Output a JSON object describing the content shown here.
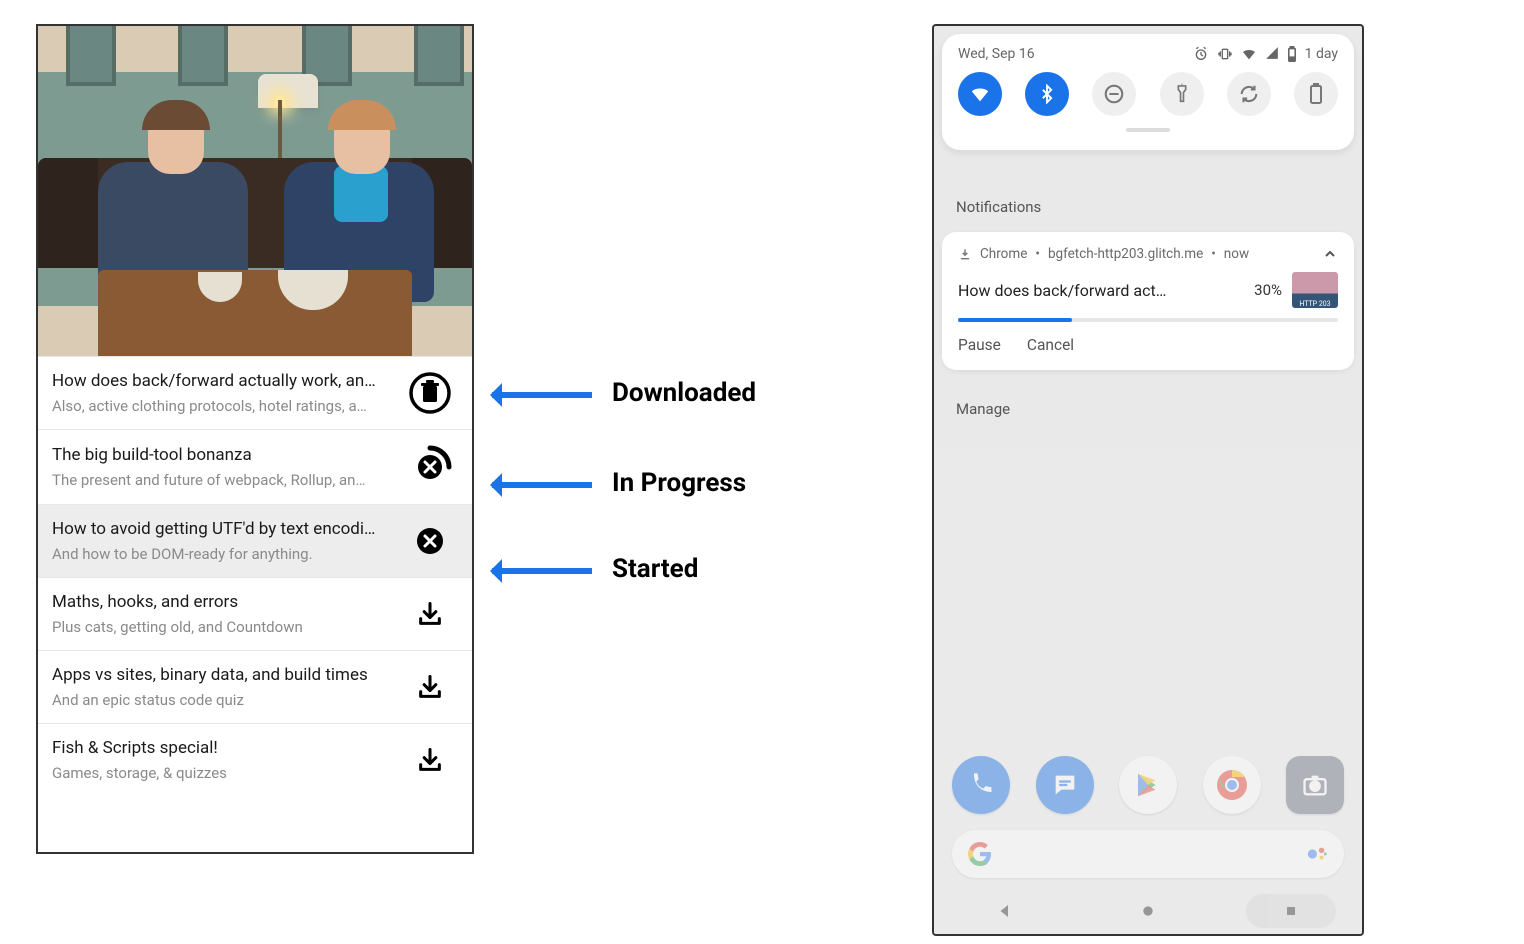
{
  "annotations": {
    "downloaded": "Downloaded",
    "inprogress": "In Progress",
    "started": "Started"
  },
  "episodes": [
    {
      "title": "How does back/forward actually work, an…",
      "sub": "Also, active clothing protocols, hotel ratings, a…",
      "icon": "trash-circle",
      "status": "downloaded"
    },
    {
      "title": "The big build-tool bonanza",
      "sub": "The present and future of webpack, Rollup, an…",
      "icon": "cancel-progress",
      "status": "in-progress"
    },
    {
      "title": "How to avoid getting UTF'd by text encodi…",
      "sub": "And how to be DOM-ready for anything.",
      "icon": "cancel-solid",
      "status": "started",
      "highlight": true
    },
    {
      "title": "Maths, hooks, and errors",
      "sub": "Plus cats, getting old, and Countdown",
      "icon": "download",
      "status": "idle"
    },
    {
      "title": "Apps vs sites, binary data, and build times",
      "sub": "And an epic status code quiz",
      "icon": "download",
      "status": "idle"
    },
    {
      "title": "Fish & Scripts special!",
      "sub": "Games, storage, & quizzes",
      "icon": "download",
      "status": "idle"
    }
  ],
  "shade": {
    "date": "Wed, Sep 16",
    "battery_label": "1 day",
    "section": "Notifications",
    "manage": "Manage"
  },
  "notification": {
    "app": "Chrome",
    "source": "bgfetch-http203.glitch.me",
    "when": "now",
    "title": "How does back/forward act…",
    "percent_text": "30%",
    "percent_value": 30,
    "thumb_label": "HTTP 203",
    "actions": {
      "pause": "Pause",
      "cancel": "Cancel"
    }
  }
}
